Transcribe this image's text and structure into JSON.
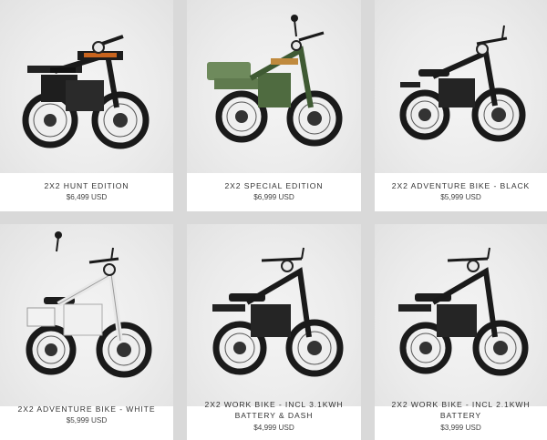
{
  "products": [
    {
      "name": "2X2 HUNT EDITION",
      "price": "$6,499 USD",
      "variant": "hunt"
    },
    {
      "name": "2X2 SPECIAL EDITION",
      "price": "$6,999 USD",
      "variant": "special"
    },
    {
      "name": "2X2 ADVENTURE BIKE - BLACK",
      "price": "$5,999 USD",
      "variant": "black"
    },
    {
      "name": "2X2 ADVENTURE BIKE - WHITE",
      "price": "$5,999 USD",
      "variant": "white"
    },
    {
      "name_line1": "2X2 WORK BIKE - INCL 3.1KWH",
      "name_line2": "BATTERY & DASH",
      "price": "$4,999 USD",
      "variant": "work"
    },
    {
      "name_line1": "2X2 WORK BIKE - INCL 2.1KWH",
      "name_line2": "BATTERY",
      "price": "$3,999 USD",
      "variant": "work"
    }
  ],
  "colors": {
    "page_background": "#d9d9d9",
    "card_background": "#ffffff",
    "bike_dark": "#1c1c1c",
    "hunt_accent": "#c8641e",
    "special_green": "#5f7a4e",
    "white_frame": "#f2f2f2"
  }
}
